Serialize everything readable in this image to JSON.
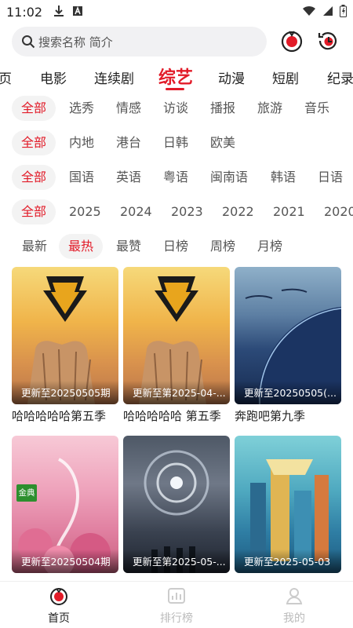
{
  "status_bar": {
    "time": "11:02"
  },
  "search": {
    "placeholder": "搜索名称 简介"
  },
  "category_tabs": [
    "页",
    "电影",
    "连续剧",
    "综艺",
    "动漫",
    "短剧",
    "纪录"
  ],
  "active_category": "综艺",
  "filters": {
    "type": [
      "全部",
      "选秀",
      "情感",
      "访谈",
      "播报",
      "旅游",
      "音乐"
    ],
    "region": [
      "全部",
      "内地",
      "港台",
      "日韩",
      "欧美"
    ],
    "language": [
      "全部",
      "国语",
      "英语",
      "粤语",
      "闽南语",
      "韩语",
      "日语"
    ],
    "year": [
      "全部",
      "2025",
      "2024",
      "2023",
      "2022",
      "2021",
      "2020"
    ],
    "sort": [
      "最新",
      "最热",
      "最赞",
      "日榜",
      "周榜",
      "月榜"
    ]
  },
  "active_filters": {
    "type": "全部",
    "region": "全部",
    "language": "全部",
    "year": "全部",
    "sort": "最热"
  },
  "cards": [
    {
      "title": "哈哈哈哈哈第五季",
      "update": "更新至20250505期"
    },
    {
      "title": "哈哈哈哈哈 第五季",
      "update": "更新至第2025-04-..."
    },
    {
      "title": "奔跑吧第九季",
      "update": "更新至20250505(..."
    },
    {
      "title": "",
      "update": "更新至20250504期",
      "badge": "金典"
    },
    {
      "title": "",
      "update": "更新至第2025-05-..."
    },
    {
      "title": "",
      "update": "更新至2025-05-03"
    }
  ],
  "bottom_nav": [
    {
      "label": "首页",
      "icon": "home-icon",
      "active": true
    },
    {
      "label": "排行榜",
      "icon": "ranking-icon",
      "active": false
    },
    {
      "label": "我的",
      "icon": "profile-icon",
      "active": false
    }
  ],
  "colors": {
    "accent": "#e21b28",
    "chip_bg": "#f3f3f3",
    "search_bg": "#f1f1f3"
  }
}
